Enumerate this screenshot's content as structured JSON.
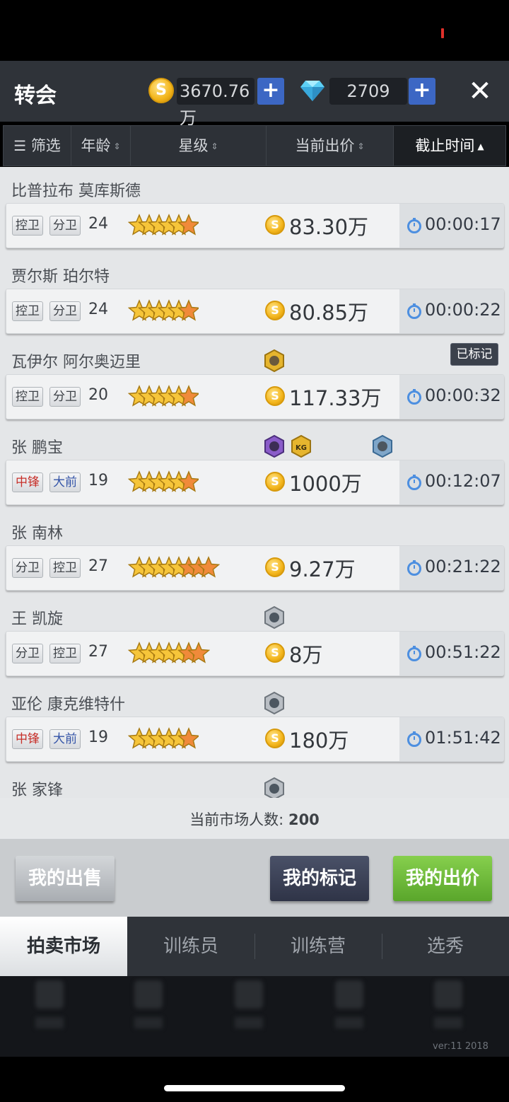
{
  "header": {
    "title": "转会",
    "coins": "3670.76万",
    "gems": "2709",
    "plus_label": "+",
    "close_label": "✕"
  },
  "sortbar": {
    "filter": "筛选",
    "age": "年龄",
    "stars": "星级",
    "bid": "当前出价",
    "deadline": "截止时间"
  },
  "players": [
    {
      "name": "比普拉布 莫库斯德",
      "pos1": "控卫",
      "pos2": "分卫",
      "age": "24",
      "stars": 5,
      "half": 1,
      "price": "83.30万",
      "time": "00:00:17",
      "marked": ""
    },
    {
      "name": "贾尔斯 珀尔特",
      "pos1": "控卫",
      "pos2": "分卫",
      "age": "24",
      "stars": 5,
      "half": 1,
      "price": "80.85万",
      "time": "00:00:22",
      "marked": ""
    },
    {
      "name": "瓦伊尔 阿尔奥迈里",
      "pos1": "控卫",
      "pos2": "分卫",
      "age": "20",
      "stars": 5,
      "half": 1,
      "price": "117.33万",
      "time": "00:00:32",
      "marked": "已标记"
    },
    {
      "name": "张 鹏宝",
      "pos1": "中锋",
      "pos2": "大前",
      "age": "19",
      "stars": 5,
      "half": 1,
      "price": "1000万",
      "time": "00:12:07",
      "marked": ""
    },
    {
      "name": "张 南林",
      "pos1": "分卫",
      "pos2": "控卫",
      "age": "27",
      "stars": 7,
      "half": 1,
      "price": "9.27万",
      "time": "00:21:22",
      "marked": ""
    },
    {
      "name": "王 凯旋",
      "pos1": "分卫",
      "pos2": "控卫",
      "age": "27",
      "stars": 6,
      "half": 1,
      "price": "8万",
      "time": "00:51:22",
      "marked": ""
    },
    {
      "name": "亚伦 康克维特什",
      "pos1": "中锋",
      "pos2": "大前",
      "age": "19",
      "stars": 5,
      "half": 1,
      "price": "180万",
      "time": "01:51:42",
      "marked": ""
    },
    {
      "name": "张 家锋"
    }
  ],
  "market": {
    "label": "当前市场人数:",
    "count": "200"
  },
  "actions": {
    "my_sales": "我的出售",
    "my_marks": "我的标记",
    "my_bids": "我的出价"
  },
  "tabs": [
    "拍卖市场",
    "训练员",
    "训练营",
    "选秀"
  ],
  "version": "ver:11  2018",
  "colors": {
    "header_bg": "#2f3339",
    "plus_blue": "#3c67c4",
    "bids_green": "#6fbb3a",
    "marks_navy": "#3a4054",
    "coin_gold": "#f3b51b"
  }
}
